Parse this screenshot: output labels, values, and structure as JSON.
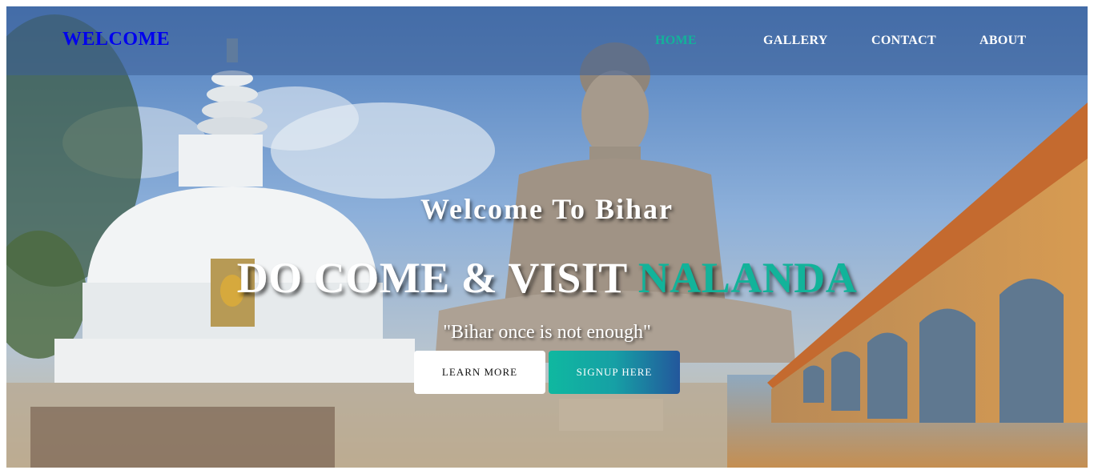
{
  "header": {
    "logo_text": "WELCOME",
    "nav": [
      {
        "label": "HOME",
        "active": true
      },
      {
        "label": "GALLERY",
        "active": false
      },
      {
        "label": "CONTACT",
        "active": false
      },
      {
        "label": "ABOUT",
        "active": false
      }
    ]
  },
  "hero": {
    "subtitle": "Welcome To Bihar",
    "title_main": "DO COME & VISIT ",
    "title_accent": "NALANDA",
    "tagline": "\"Bihar once is not enough\"",
    "buttons": {
      "learn_more": "LEARN MORE",
      "signup": "SIGNUP HERE"
    }
  },
  "colors": {
    "accent": "#12b39a",
    "logo": "#0000ee",
    "signup_gradient_end": "#23579c"
  }
}
